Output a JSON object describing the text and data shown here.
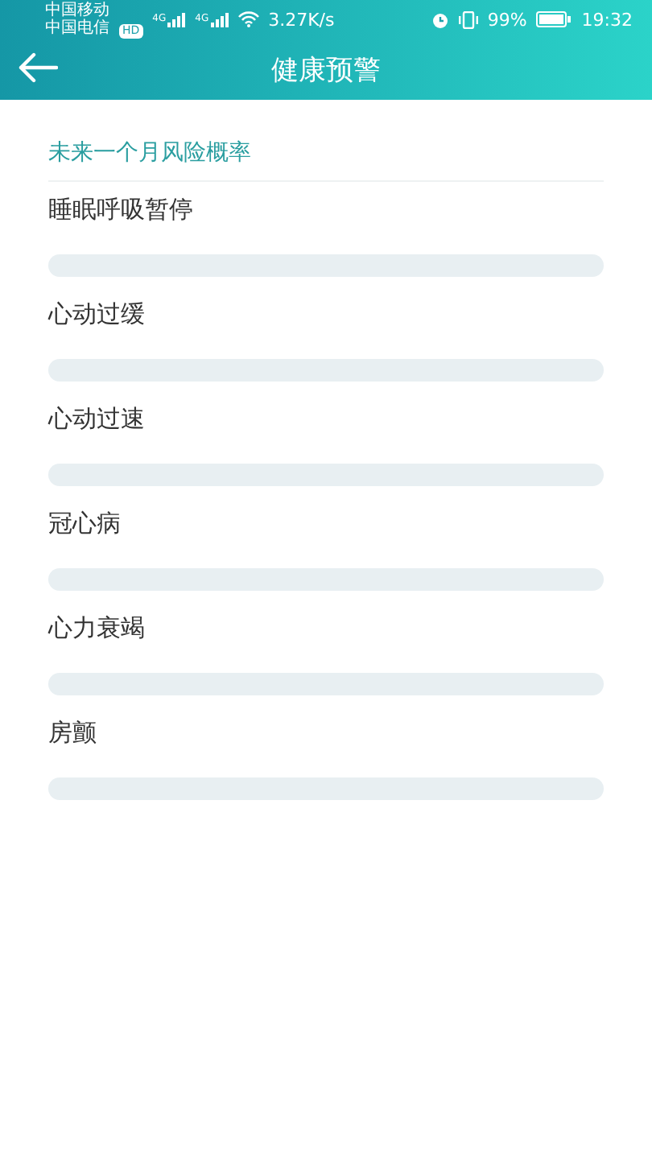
{
  "status_bar": {
    "carriers": [
      "中国移动",
      "中国电信"
    ],
    "hd_badge": "HD",
    "signal_labels": [
      "4G",
      "4G"
    ],
    "net_speed": "3.27K/s",
    "battery_percent": "99%",
    "time": "19:32"
  },
  "header": {
    "title": "健康预警"
  },
  "section": {
    "title": "未来一个月风险概率"
  },
  "risks": [
    {
      "name": "睡眠呼吸暂停",
      "level": 0
    },
    {
      "name": "心动过缓",
      "level": 0
    },
    {
      "name": "心动过速",
      "level": 0
    },
    {
      "name": "冠心病",
      "level": 0
    },
    {
      "name": "心力衰竭",
      "level": 0
    },
    {
      "name": "房颤",
      "level": 0
    }
  ]
}
